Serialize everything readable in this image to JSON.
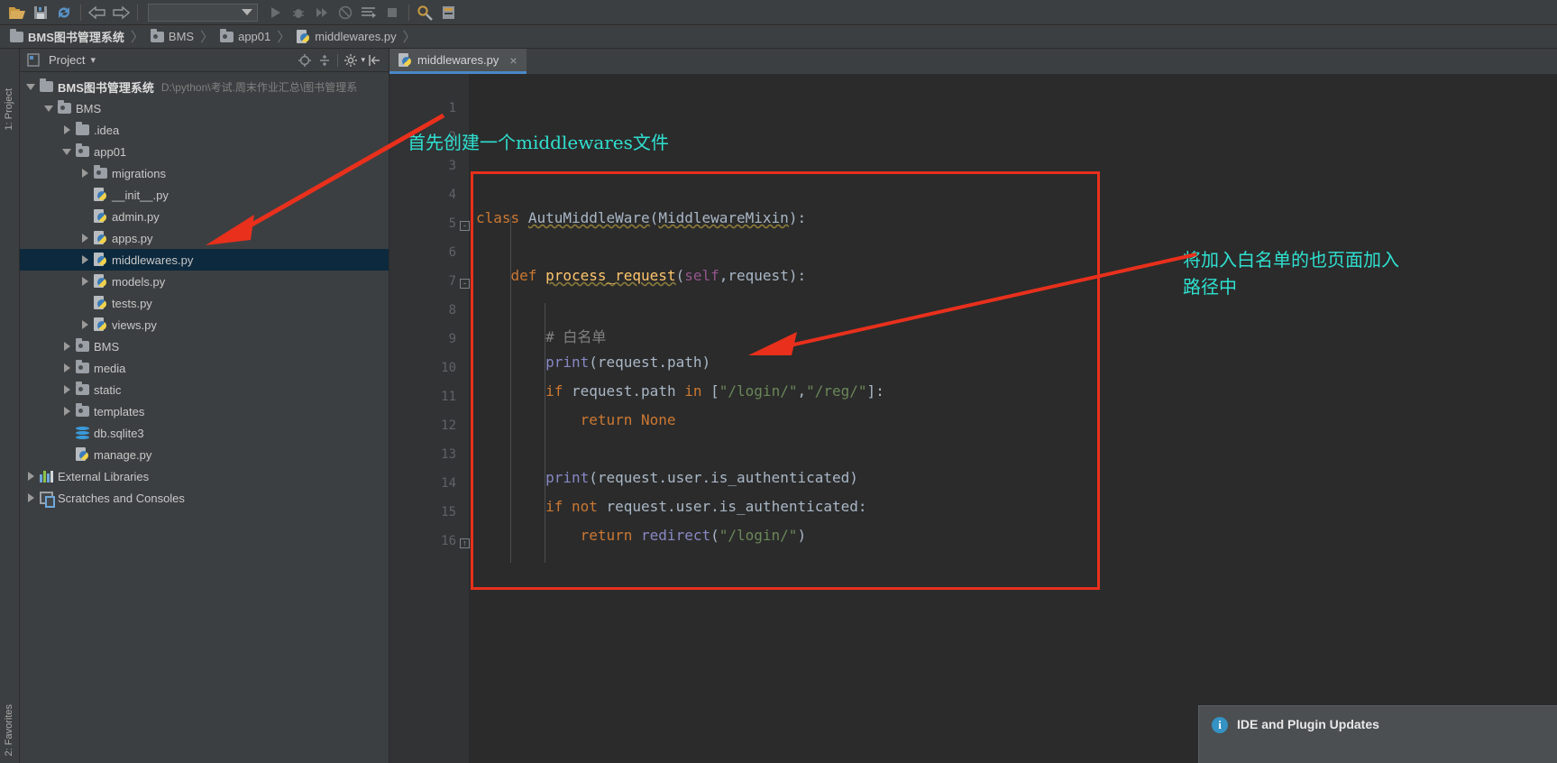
{
  "toolbar": {
    "icons": [
      {
        "name": "open-folder-icon",
        "glyph": "folder"
      },
      {
        "name": "save-all-icon",
        "glyph": "save"
      },
      {
        "name": "sync-icon",
        "glyph": "sync"
      },
      {
        "name": "back-icon",
        "glyph": "arrow-left"
      },
      {
        "name": "forward-icon",
        "glyph": "arrow-right"
      },
      {
        "name": "run-icon",
        "glyph": "play"
      },
      {
        "name": "debug-icon",
        "glyph": "bug"
      },
      {
        "name": "run-coverage-icon",
        "glyph": "fast-forward"
      },
      {
        "name": "stop-icon",
        "glyph": "no-entry"
      },
      {
        "name": "show-console-icon",
        "glyph": "lines"
      },
      {
        "name": "terminate-icon",
        "glyph": "square"
      },
      {
        "name": "settings-icon",
        "glyph": "wrench"
      },
      {
        "name": "project-structure-icon",
        "glyph": "structure"
      }
    ],
    "run_config_value": ""
  },
  "breadcrumb": {
    "items": [
      {
        "label": "BMS图书管理系统",
        "icon": "folder-icon"
      },
      {
        "label": "BMS",
        "icon": "folder-icon"
      },
      {
        "label": "app01",
        "icon": "folder-icon"
      },
      {
        "label": "middlewares.py",
        "icon": "python-file-icon"
      }
    ],
    "separator": "〉"
  },
  "left_rail": {
    "project_label": "1: Project",
    "favorites_label": "2: Favorites"
  },
  "project_panel": {
    "title": "Project",
    "dropdown_caret": "▾",
    "header_icons": [
      {
        "name": "locate-icon"
      },
      {
        "name": "collapse-all-icon"
      },
      {
        "name": "settings-gear-icon"
      },
      {
        "name": "hide-panel-icon"
      }
    ],
    "tree": [
      {
        "label": "BMS图书管理系统",
        "path": "D:\\python\\考试.周末作业汇总\\图书管理系",
        "indent": 0,
        "arrow": "down",
        "icon": "folder",
        "bold": true,
        "selected": false
      },
      {
        "label": "BMS",
        "path": "",
        "indent": 1,
        "arrow": "down",
        "icon": "folder-src",
        "bold": false,
        "selected": false
      },
      {
        "label": ".idea",
        "path": "",
        "indent": 2,
        "arrow": "right",
        "icon": "folder",
        "bold": false,
        "selected": false
      },
      {
        "label": "app01",
        "path": "",
        "indent": 2,
        "arrow": "down",
        "icon": "folder-src",
        "bold": false,
        "selected": false
      },
      {
        "label": "migrations",
        "path": "",
        "indent": 3,
        "arrow": "right",
        "icon": "folder-src",
        "bold": false,
        "selected": false
      },
      {
        "label": "__init__.py",
        "path": "",
        "indent": 3,
        "arrow": "none",
        "icon": "python",
        "bold": false,
        "selected": false
      },
      {
        "label": "admin.py",
        "path": "",
        "indent": 3,
        "arrow": "none",
        "icon": "python",
        "bold": false,
        "selected": false
      },
      {
        "label": "apps.py",
        "path": "",
        "indent": 3,
        "arrow": "right",
        "icon": "python",
        "bold": false,
        "selected": false
      },
      {
        "label": "middlewares.py",
        "path": "",
        "indent": 3,
        "arrow": "right",
        "icon": "python",
        "bold": false,
        "selected": true
      },
      {
        "label": "models.py",
        "path": "",
        "indent": 3,
        "arrow": "right",
        "icon": "python",
        "bold": false,
        "selected": false
      },
      {
        "label": "tests.py",
        "path": "",
        "indent": 3,
        "arrow": "none",
        "icon": "python",
        "bold": false,
        "selected": false
      },
      {
        "label": "views.py",
        "path": "",
        "indent": 3,
        "arrow": "right",
        "icon": "python",
        "bold": false,
        "selected": false
      },
      {
        "label": "BMS",
        "path": "",
        "indent": 2,
        "arrow": "right",
        "icon": "folder-src",
        "bold": false,
        "selected": false
      },
      {
        "label": "media",
        "path": "",
        "indent": 2,
        "arrow": "right",
        "icon": "folder-src",
        "bold": false,
        "selected": false
      },
      {
        "label": "static",
        "path": "",
        "indent": 2,
        "arrow": "right",
        "icon": "folder-src",
        "bold": false,
        "selected": false
      },
      {
        "label": "templates",
        "path": "",
        "indent": 2,
        "arrow": "right",
        "icon": "folder-src",
        "bold": false,
        "selected": false
      },
      {
        "label": "db.sqlite3",
        "path": "",
        "indent": 2,
        "arrow": "none",
        "icon": "sqlite",
        "bold": false,
        "selected": false
      },
      {
        "label": "manage.py",
        "path": "",
        "indent": 2,
        "arrow": "none",
        "icon": "python",
        "bold": false,
        "selected": false
      },
      {
        "label": "External Libraries",
        "path": "",
        "indent": 0,
        "arrow": "right",
        "icon": "library",
        "bold": false,
        "selected": false
      },
      {
        "label": "Scratches and Consoles",
        "path": "",
        "indent": 0,
        "arrow": "right",
        "icon": "scratch",
        "bold": false,
        "selected": false
      }
    ]
  },
  "editor": {
    "tab": {
      "label": "middlewares.py",
      "icon": "python-file-icon",
      "close": "×"
    },
    "line_numbers": [
      1,
      2,
      3,
      4,
      5,
      6,
      7,
      8,
      9,
      10,
      11,
      12,
      13,
      14,
      15,
      16
    ],
    "code_lines": [
      {
        "n": 1,
        "text": ""
      },
      {
        "n": 2,
        "text": ""
      },
      {
        "n": 3,
        "text": ""
      },
      {
        "n": 4,
        "text": ""
      },
      {
        "n": 5,
        "text": "class AutuMiddleWare(MiddlewareMixin):"
      },
      {
        "n": 6,
        "text": ""
      },
      {
        "n": 7,
        "text": "    def process_request(self,request):"
      },
      {
        "n": 8,
        "text": ""
      },
      {
        "n": 9,
        "text": "        # 白名单"
      },
      {
        "n": 10,
        "text": "        print(request.path)"
      },
      {
        "n": 11,
        "text": "        if request.path in [\"/login/\",\"/reg/\"]:"
      },
      {
        "n": 12,
        "text": "            return None"
      },
      {
        "n": 13,
        "text": ""
      },
      {
        "n": 14,
        "text": "        print(request.user.is_authenticated)"
      },
      {
        "n": 15,
        "text": "        if not request.user.is_authenticated:"
      },
      {
        "n": 16,
        "text": "            return redirect(\"/login/\")"
      }
    ]
  },
  "annotations": {
    "top_note": "首先创建一个middlewares文件",
    "right_note_line1": "将加入白名单的也页面加入",
    "right_note_line2": "路径中",
    "highlight_color": "#e8301c",
    "note_color": "#2fe0d0"
  },
  "notification": {
    "icon": "info-icon",
    "icon_glyph": "i",
    "title": "IDE and Plugin Updates"
  }
}
